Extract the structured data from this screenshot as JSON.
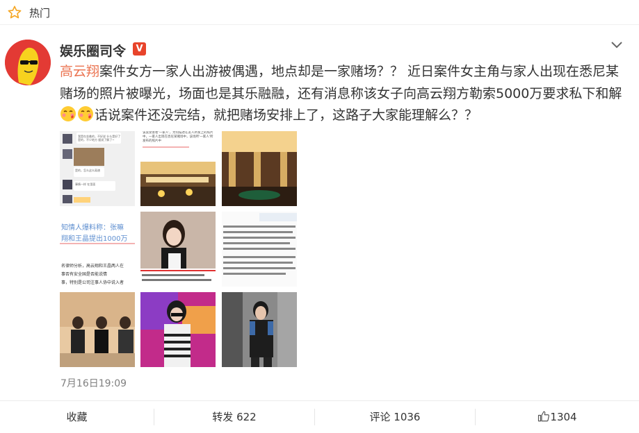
{
  "header": {
    "title": "热门"
  },
  "post": {
    "author": "娱乐圈司令",
    "verified_badge": "V",
    "mention": "高云翔",
    "text_part1": "案件女方一家人出游被偶遇，地点却是一家赌场？？ 近日案件女主角与家人出现在悉尼某赌场的照片被曝光，场面也是其乐融融，还有消息称该女子向高云翔方勒索5000万要求私下和解",
    "text_part2": "话说案件还没完结，就把赌场安排上了，这路子大家能理解么？？",
    "timestamp": "7月16日19:09",
    "images": [
      {
        "alt": "聊天截图",
        "texts": [
          "我是在坐着的，不好说 什么是好了",
          "是的，不少地方 据说了解了~",
          "是的，怎么这么离谱",
          "事情一样 在里面"
        ]
      },
      {
        "alt": "赌场截图",
        "texts": [
          "该案受害者'一家人'，为何描述在友人所发上的照片中，一家人出现在悉尼某赌场中，该场所'一家人'所发布的照片中"
        ]
      },
      {
        "alt": "赌场大厅"
      },
      {
        "alt": "知情人爆料",
        "texts": [
          "知情人爆料称：张嘛",
          "翔和王晶提出1000万",
          "名律师分析，高云翔和王晶两人在",
          "事否有安全国是否能说情",
          "事，特别是公司注事人协中说入者"
        ]
      },
      {
        "alt": "女子照片"
      },
      {
        "alt": "新闻文本"
      },
      {
        "alt": "论坛照片"
      },
      {
        "alt": "女子自拍"
      },
      {
        "alt": "男子街拍"
      }
    ]
  },
  "actions": {
    "favorite": "收藏",
    "repost": "转发 622",
    "comment": "评论 1036",
    "like": "1304"
  },
  "colors": {
    "mention": "#eb7350",
    "badge": "#e8442b",
    "star": "#f5a623"
  }
}
